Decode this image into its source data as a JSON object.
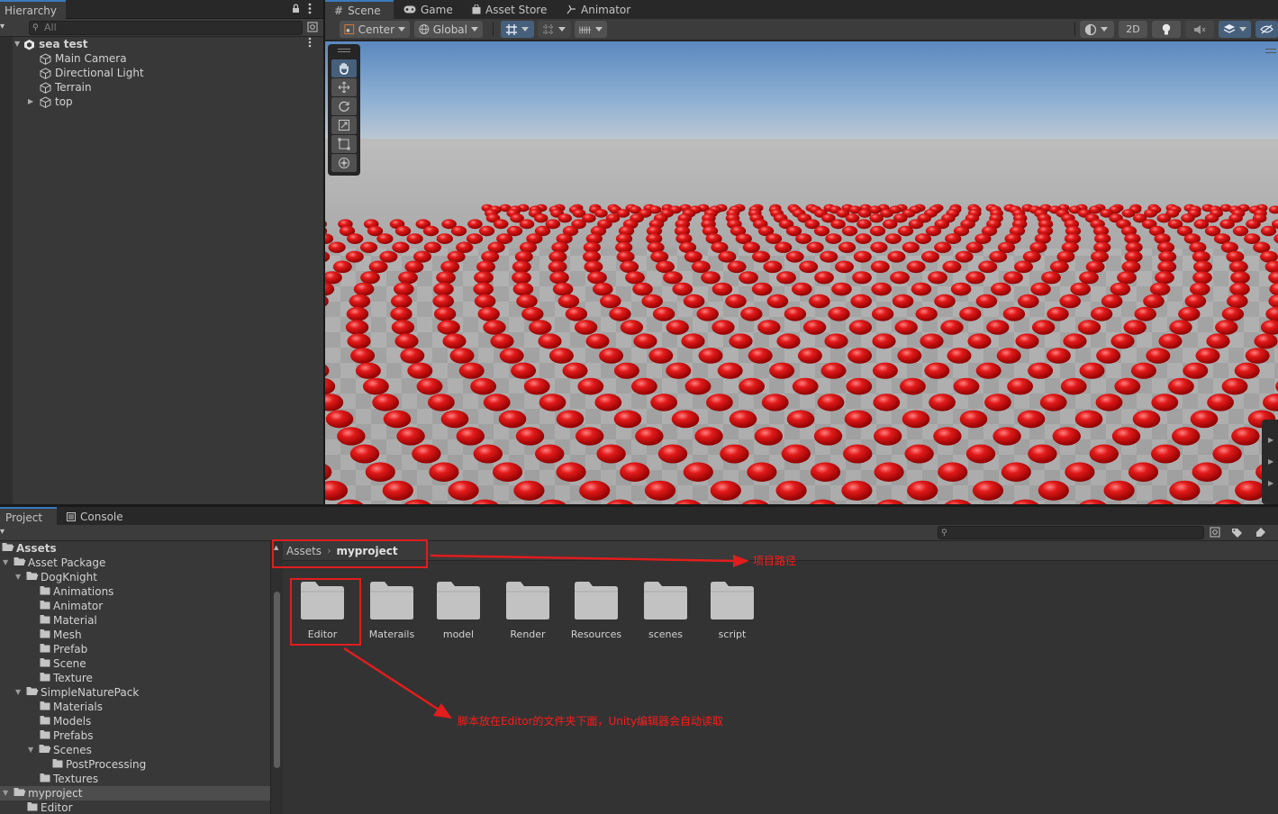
{
  "hierarchy": {
    "tab_label": "Hierarchy",
    "search_placeholder": "All",
    "scene_name": "sea test",
    "objects": [
      "Main Camera",
      "Directional Light",
      "Terrain",
      "top"
    ]
  },
  "scene_view": {
    "tabs": [
      "Scene",
      "Game",
      "Asset Store",
      "Animator"
    ],
    "pivot_label": "Center",
    "space_label": "Global",
    "mode_2d_label": "2D"
  },
  "project": {
    "tabs": [
      "Project",
      "Console"
    ],
    "tree": {
      "root": "Assets",
      "asset_package": "Asset Package",
      "dogknight": "DogKnight",
      "dogknight_children": [
        "Animations",
        "Animator",
        "Material",
        "Mesh",
        "Prefab",
        "Scene",
        "Texture"
      ],
      "simplenaturepack": "SimpleNaturePack",
      "snp_children": [
        "Materials",
        "Models",
        "Prefabs"
      ],
      "scenes": "Scenes",
      "postprocessing": "PostProcessing",
      "textures": "Textures",
      "myproject": "myproject",
      "editor": "Editor"
    },
    "breadcrumb": {
      "root": "Assets",
      "current": "myproject"
    },
    "folders": [
      "Editor",
      "Materails",
      "model",
      "Render",
      "Resources",
      "scenes",
      "script"
    ]
  },
  "annotations": {
    "path_note": "项目路径",
    "editor_note": "脚本放在Editor的文件夹下面，Unity编辑器会自动读取"
  },
  "colors": {
    "accent": "#3a79bb",
    "annotation_red": "#e11d1d",
    "sphere_red": "#d01414"
  }
}
